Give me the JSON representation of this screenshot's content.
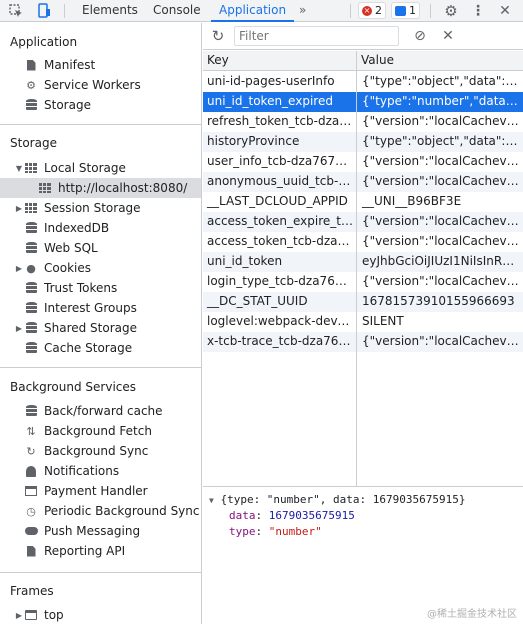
{
  "toolbar": {
    "tabs": [
      "Elements",
      "Console",
      "Application"
    ],
    "more": "»",
    "errors_count": "2",
    "messages_count": "1"
  },
  "sidebar": {
    "application": {
      "title": "Application",
      "items": [
        "Manifest",
        "Service Workers",
        "Storage"
      ]
    },
    "storage": {
      "title": "Storage",
      "local_storage": "Local Storage",
      "local_origin": "http://localhost:8080/",
      "items": [
        "Session Storage",
        "IndexedDB",
        "Web SQL",
        "Cookies",
        "Trust Tokens",
        "Interest Groups",
        "Shared Storage",
        "Cache Storage"
      ]
    },
    "background": {
      "title": "Background Services",
      "items": [
        "Back/forward cache",
        "Background Fetch",
        "Background Sync",
        "Notifications",
        "Payment Handler",
        "Periodic Background Sync",
        "Push Messaging",
        "Reporting API"
      ]
    },
    "frames": {
      "title": "Frames",
      "items": [
        "top"
      ]
    }
  },
  "filter": {
    "placeholder": "Filter"
  },
  "table": {
    "headers": [
      "Key",
      "Value"
    ],
    "selected_index": 1,
    "rows": [
      {
        "key": "uni-id-pages-userInfo",
        "value": "{\"type\":\"object\",\"data\":{\"_i"
      },
      {
        "key": "uni_id_token_expired",
        "value": "{\"type\":\"number\",\"data\":1..."
      },
      {
        "key": "refresh_token_tcb-dza767...",
        "value": "{\"version\":\"localCachev1\",..."
      },
      {
        "key": "historyProvince",
        "value": "{\"type\":\"object\",\"data\":{\"p..."
      },
      {
        "key": "user_info_tcb-dza767nid2...",
        "value": "{\"version\":\"localCachev1\",..."
      },
      {
        "key": "anonymous_uuid_tcb-dza...",
        "value": "{\"version\":\"localCachev1\",..."
      },
      {
        "key": "__LAST_DCLOUD_APPID",
        "value": "__UNI__B96BF3E"
      },
      {
        "key": "access_token_expire_tcb-...",
        "value": "{\"version\":\"localCachev1\",..."
      },
      {
        "key": "access_token_tcb-dza767...",
        "value": "{\"version\":\"localCachev1\",..."
      },
      {
        "key": "uni_id_token",
        "value": "eyJhbGciOiJIUzI1NiIsInR5..."
      },
      {
        "key": "login_type_tcb-dza767nid...",
        "value": "{\"version\":\"localCachev1\",..."
      },
      {
        "key": "__DC_STAT_UUID",
        "value": "16781573910155966693"
      },
      {
        "key": "loglevel:webpack-dev-ser...",
        "value": "SILENT"
      },
      {
        "key": "x-tcb-trace_tcb-dza767ni...",
        "value": "{\"version\":\"localCachev1\",..."
      }
    ]
  },
  "preview": {
    "summary": "{type: \"number\", data: 1679035675915}",
    "data_key": "data",
    "data_value": "1679035675915",
    "type_key": "type",
    "type_value": "\"number\""
  },
  "watermark": "@稀土掘金技术社区"
}
